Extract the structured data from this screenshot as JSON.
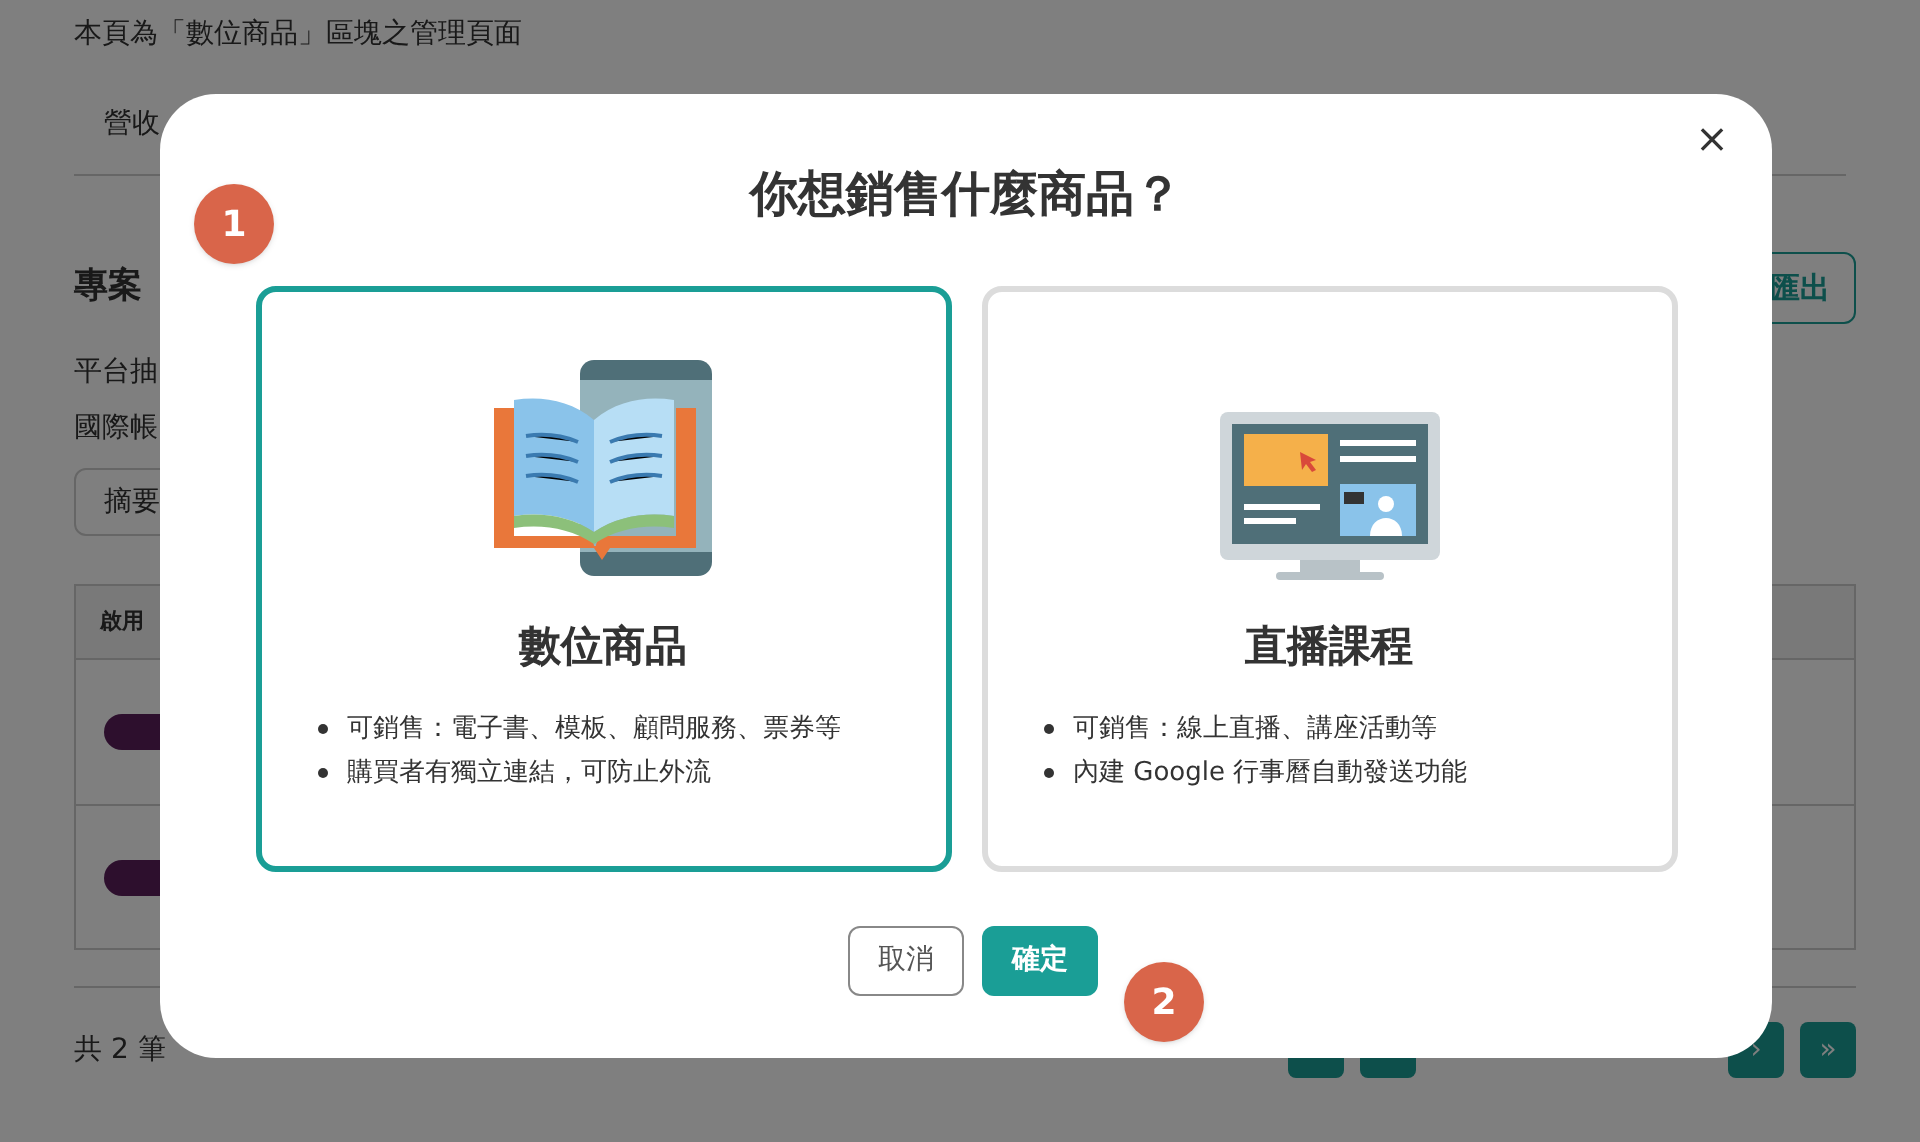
{
  "page": {
    "description": "本頁為「數位商品」區塊之管理頁面",
    "tab": "營收",
    "section_title": "專案",
    "export_button": "匯出",
    "info_lines": [
      "平台抽",
      "國際帳"
    ],
    "filter_field": {
      "value": "摘要"
    },
    "table": {
      "columns": [
        "啟用"
      ],
      "rows": [
        {
          "enabled": true
        },
        {
          "enabled": true
        }
      ]
    },
    "total": "共 2 筆",
    "pagination": {
      "buttons": [
        "›",
        "»"
      ]
    }
  },
  "dialog": {
    "title": "你想銷售什麼商品？",
    "close": "×",
    "options": [
      {
        "kind": "ebook",
        "name": "數位商品",
        "selected": true,
        "points": [
          "可銷售：電子書、模板、顧問服務、票券等",
          "購買者有獨立連結，可防止外流"
        ]
      },
      {
        "kind": "live",
        "name": "直播課程",
        "selected": false,
        "points": [
          "可銷售：線上直播、講座活動等",
          "內建 Google 行事曆自動發送功能"
        ]
      }
    ],
    "buttons": [
      {
        "label": "取消",
        "kind": "secondary"
      },
      {
        "label": "確定",
        "kind": "primary"
      }
    ],
    "step_markers": [
      "1",
      "2"
    ]
  }
}
